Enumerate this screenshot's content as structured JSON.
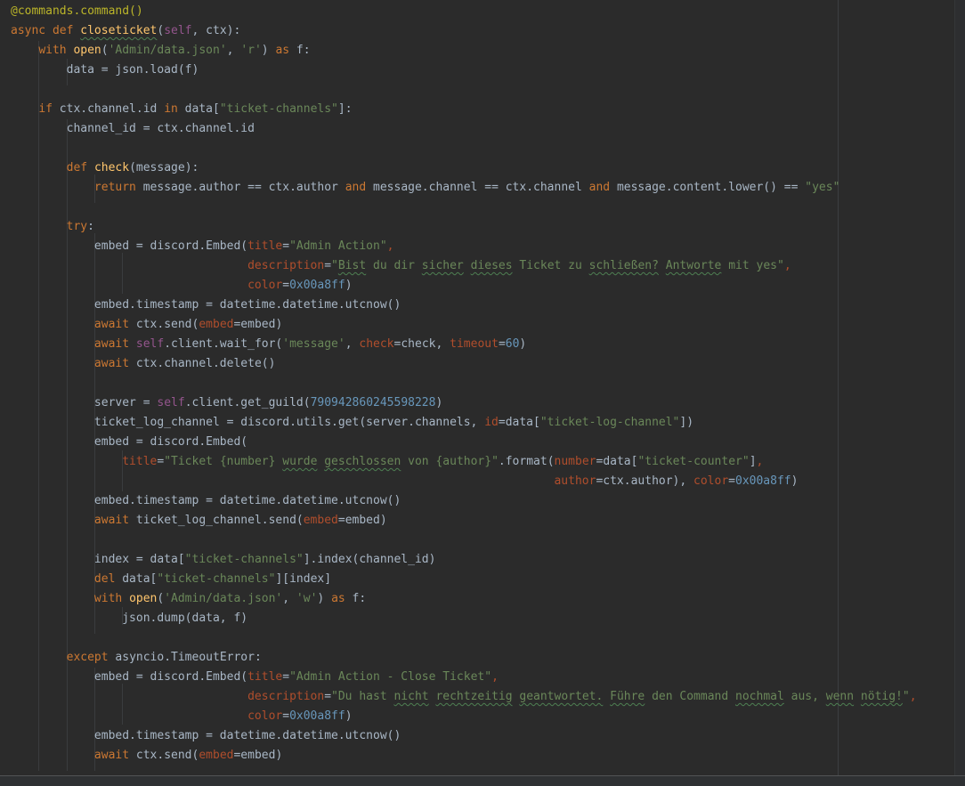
{
  "editor": {
    "language": "python",
    "palette": {
      "bg": "#2b2b2b",
      "d": "#a9b7c6",
      "kw": "#cc7832",
      "dec": "#bbb529",
      "fn": "#ffc66d",
      "str": "#6a8759",
      "num": "#6897bb",
      "self": "#94558d",
      "arg": "#b04e2c",
      "embed_color_value": "0x00a8ff",
      "guild_id": "790942860245598228",
      "timeout_value": "60"
    },
    "lines": [
      [
        {
          "t": "@commands.command()",
          "c": "dec"
        }
      ],
      [
        {
          "t": "async",
          "c": "kw"
        },
        {
          "t": " ",
          "c": "d"
        },
        {
          "t": "def",
          "c": "kw"
        },
        {
          "t": " ",
          "c": "d"
        },
        {
          "t": "closeticket",
          "c": "fn",
          "u": 1
        },
        {
          "t": "(",
          "c": "d"
        },
        {
          "t": "self",
          "c": "self"
        },
        {
          "t": ", ctx):",
          "c": "d"
        }
      ],
      [
        {
          "t": "    ",
          "c": "d"
        },
        {
          "t": "with",
          "c": "kw"
        },
        {
          "t": " ",
          "c": "d"
        },
        {
          "t": "open",
          "c": "fn"
        },
        {
          "t": "(",
          "c": "d"
        },
        {
          "t": "'Admin/data.json'",
          "c": "str"
        },
        {
          "t": ", ",
          "c": "d"
        },
        {
          "t": "'r'",
          "c": "str"
        },
        {
          "t": ") ",
          "c": "d"
        },
        {
          "t": "as",
          "c": "kw"
        },
        {
          "t": " f:",
          "c": "d"
        }
      ],
      [
        {
          "t": "        data = json.load(f)",
          "c": "d"
        }
      ],
      [],
      [
        {
          "t": "    ",
          "c": "d"
        },
        {
          "t": "if",
          "c": "kw"
        },
        {
          "t": " ctx.channel.id ",
          "c": "d"
        },
        {
          "t": "in",
          "c": "kw"
        },
        {
          "t": " data[",
          "c": "d"
        },
        {
          "t": "\"ticket-channels\"",
          "c": "str"
        },
        {
          "t": "]:",
          "c": "d"
        }
      ],
      [
        {
          "t": "        channel_id = ctx.channel.id",
          "c": "d"
        }
      ],
      [],
      [
        {
          "t": "        ",
          "c": "d"
        },
        {
          "t": "def",
          "c": "kw"
        },
        {
          "t": " ",
          "c": "d"
        },
        {
          "t": "check",
          "c": "fn"
        },
        {
          "t": "(message):",
          "c": "d"
        }
      ],
      [
        {
          "t": "            ",
          "c": "d"
        },
        {
          "t": "return",
          "c": "kw"
        },
        {
          "t": " message.author == ctx.author ",
          "c": "d"
        },
        {
          "t": "and",
          "c": "kw"
        },
        {
          "t": " message.channel == ctx.channel ",
          "c": "d"
        },
        {
          "t": "and",
          "c": "kw"
        },
        {
          "t": " message.content.lower() == ",
          "c": "d"
        },
        {
          "t": "\"yes\"",
          "c": "str"
        }
      ],
      [],
      [
        {
          "t": "        ",
          "c": "d"
        },
        {
          "t": "try",
          "c": "kw"
        },
        {
          "t": ":",
          "c": "d"
        }
      ],
      [
        {
          "t": "            embed = discord.Embed(",
          "c": "d"
        },
        {
          "t": "title",
          "c": "arg"
        },
        {
          "t": "=",
          "c": "d"
        },
        {
          "t": "\"Admin Action\"",
          "c": "str"
        },
        {
          "t": ",",
          "c": "arg"
        }
      ],
      [
        {
          "t": "                                  ",
          "c": "d"
        },
        {
          "t": "description",
          "c": "arg"
        },
        {
          "t": "=",
          "c": "d"
        },
        {
          "t": "\"",
          "c": "str"
        },
        {
          "t": "Bist",
          "c": "str",
          "u": 1
        },
        {
          "t": " du dir ",
          "c": "str"
        },
        {
          "t": "sicher",
          "c": "str",
          "u": 1
        },
        {
          "t": " ",
          "c": "str"
        },
        {
          "t": "dieses",
          "c": "str",
          "u": 1
        },
        {
          "t": " Ticket zu ",
          "c": "str"
        },
        {
          "t": "schließen?",
          "c": "str",
          "u": 1
        },
        {
          "t": " ",
          "c": "str"
        },
        {
          "t": "Antworte",
          "c": "str",
          "u": 1
        },
        {
          "t": " mit yes\"",
          "c": "str"
        },
        {
          "t": ",",
          "c": "arg"
        }
      ],
      [
        {
          "t": "                                  ",
          "c": "d"
        },
        {
          "t": "color",
          "c": "arg"
        },
        {
          "t": "=",
          "c": "d"
        },
        {
          "t": "0x00a8ff",
          "c": "num"
        },
        {
          "t": ")",
          "c": "d"
        }
      ],
      [
        {
          "t": "            embed.timestamp = datetime.datetime.utcnow()",
          "c": "d"
        }
      ],
      [
        {
          "t": "            ",
          "c": "d"
        },
        {
          "t": "await",
          "c": "kw"
        },
        {
          "t": " ctx.send(",
          "c": "d"
        },
        {
          "t": "embed",
          "c": "arg"
        },
        {
          "t": "=embed)",
          "c": "d"
        }
      ],
      [
        {
          "t": "            ",
          "c": "d"
        },
        {
          "t": "await",
          "c": "kw"
        },
        {
          "t": " ",
          "c": "d"
        },
        {
          "t": "self",
          "c": "self"
        },
        {
          "t": ".client.wait_for(",
          "c": "d"
        },
        {
          "t": "'message'",
          "c": "str"
        },
        {
          "t": ", ",
          "c": "d"
        },
        {
          "t": "check",
          "c": "arg"
        },
        {
          "t": "=check, ",
          "c": "d"
        },
        {
          "t": "timeout",
          "c": "arg"
        },
        {
          "t": "=",
          "c": "d"
        },
        {
          "t": "60",
          "c": "num"
        },
        {
          "t": ")",
          "c": "d"
        }
      ],
      [
        {
          "t": "            ",
          "c": "d"
        },
        {
          "t": "await",
          "c": "kw"
        },
        {
          "t": " ctx.channel.delete()",
          "c": "d"
        }
      ],
      [],
      [
        {
          "t": "            server = ",
          "c": "d"
        },
        {
          "t": "self",
          "c": "self"
        },
        {
          "t": ".client.get_guild(",
          "c": "d"
        },
        {
          "t": "790942860245598228",
          "c": "num"
        },
        {
          "t": ")",
          "c": "d"
        }
      ],
      [
        {
          "t": "            ticket_log_channel = discord.utils.get(server.channels, ",
          "c": "d"
        },
        {
          "t": "id",
          "c": "arg"
        },
        {
          "t": "=data[",
          "c": "d"
        },
        {
          "t": "\"ticket-log-channel\"",
          "c": "str"
        },
        {
          "t": "])",
          "c": "d"
        }
      ],
      [
        {
          "t": "            embed = discord.Embed(",
          "c": "d"
        }
      ],
      [
        {
          "t": "                ",
          "c": "d"
        },
        {
          "t": "title",
          "c": "arg"
        },
        {
          "t": "=",
          "c": "d"
        },
        {
          "t": "\"Ticket {number} ",
          "c": "str"
        },
        {
          "t": "wurde",
          "c": "str",
          "u": 1
        },
        {
          "t": " ",
          "c": "str"
        },
        {
          "t": "geschlossen",
          "c": "str",
          "u": 1
        },
        {
          "t": " von {author}\"",
          "c": "str"
        },
        {
          "t": ".format(",
          "c": "d"
        },
        {
          "t": "number",
          "c": "arg"
        },
        {
          "t": "=data[",
          "c": "d"
        },
        {
          "t": "\"ticket-counter\"",
          "c": "str"
        },
        {
          "t": "]",
          "c": "d"
        },
        {
          "t": ",",
          "c": "arg"
        }
      ],
      [
        {
          "t": "                                                                              ",
          "c": "d"
        },
        {
          "t": "author",
          "c": "arg"
        },
        {
          "t": "=ctx.author), ",
          "c": "d"
        },
        {
          "t": "color",
          "c": "arg"
        },
        {
          "t": "=",
          "c": "d"
        },
        {
          "t": "0x00a8ff",
          "c": "num"
        },
        {
          "t": ")",
          "c": "d"
        }
      ],
      [
        {
          "t": "            embed.timestamp = datetime.datetime.utcnow()",
          "c": "d"
        }
      ],
      [
        {
          "t": "            ",
          "c": "d"
        },
        {
          "t": "await",
          "c": "kw"
        },
        {
          "t": " ticket_log_channel.send(",
          "c": "d"
        },
        {
          "t": "embed",
          "c": "arg"
        },
        {
          "t": "=embed)",
          "c": "d"
        }
      ],
      [],
      [
        {
          "t": "            index = data[",
          "c": "d"
        },
        {
          "t": "\"ticket-channels\"",
          "c": "str"
        },
        {
          "t": "].index(channel_id)",
          "c": "d"
        }
      ],
      [
        {
          "t": "            ",
          "c": "d"
        },
        {
          "t": "del",
          "c": "kw"
        },
        {
          "t": " data[",
          "c": "d"
        },
        {
          "t": "\"ticket-channels\"",
          "c": "str"
        },
        {
          "t": "][index]",
          "c": "d"
        }
      ],
      [
        {
          "t": "            ",
          "c": "d"
        },
        {
          "t": "with",
          "c": "kw"
        },
        {
          "t": " ",
          "c": "d"
        },
        {
          "t": "open",
          "c": "fn"
        },
        {
          "t": "(",
          "c": "d"
        },
        {
          "t": "'Admin/data.json'",
          "c": "str"
        },
        {
          "t": ", ",
          "c": "d"
        },
        {
          "t": "'w'",
          "c": "str"
        },
        {
          "t": ") ",
          "c": "d"
        },
        {
          "t": "as",
          "c": "kw"
        },
        {
          "t": " f:",
          "c": "d"
        }
      ],
      [
        {
          "t": "                json.dump(data, f)",
          "c": "d"
        }
      ],
      [],
      [
        {
          "t": "        ",
          "c": "d"
        },
        {
          "t": "except",
          "c": "kw"
        },
        {
          "t": " asyncio.TimeoutError:",
          "c": "d"
        }
      ],
      [
        {
          "t": "            embed = discord.Embed(",
          "c": "d"
        },
        {
          "t": "title",
          "c": "arg"
        },
        {
          "t": "=",
          "c": "d"
        },
        {
          "t": "\"Admin Action - Close Ticket\"",
          "c": "str"
        },
        {
          "t": ",",
          "c": "arg"
        }
      ],
      [
        {
          "t": "                                  ",
          "c": "d"
        },
        {
          "t": "description",
          "c": "arg"
        },
        {
          "t": "=",
          "c": "d"
        },
        {
          "t": "\"Du hast ",
          "c": "str"
        },
        {
          "t": "nicht",
          "c": "str",
          "u": 1
        },
        {
          "t": " ",
          "c": "str"
        },
        {
          "t": "rechtzeitig",
          "c": "str",
          "u": 1
        },
        {
          "t": " ",
          "c": "str"
        },
        {
          "t": "geantwortet.",
          "c": "str",
          "u": 1
        },
        {
          "t": " ",
          "c": "str"
        },
        {
          "t": "Führe",
          "c": "str",
          "u": 1
        },
        {
          "t": " den Command ",
          "c": "str"
        },
        {
          "t": "nochmal",
          "c": "str",
          "u": 1
        },
        {
          "t": " aus, ",
          "c": "str"
        },
        {
          "t": "wenn",
          "c": "str",
          "u": 1
        },
        {
          "t": " ",
          "c": "str"
        },
        {
          "t": "nötig!",
          "c": "str",
          "u": 1
        },
        {
          "t": "\"",
          "c": "str"
        },
        {
          "t": ",",
          "c": "arg"
        }
      ],
      [
        {
          "t": "                                  ",
          "c": "d"
        },
        {
          "t": "color",
          "c": "arg"
        },
        {
          "t": "=",
          "c": "d"
        },
        {
          "t": "0x00a8ff",
          "c": "num"
        },
        {
          "t": ")",
          "c": "d"
        }
      ],
      [
        {
          "t": "            embed.timestamp = datetime.datetime.utcnow()",
          "c": "d"
        }
      ],
      [
        {
          "t": "            ",
          "c": "d"
        },
        {
          "t": "await",
          "c": "kw"
        },
        {
          "t": " ctx.send(",
          "c": "d"
        },
        {
          "t": "embed",
          "c": "arg"
        },
        {
          "t": "=embed)",
          "c": "d"
        }
      ]
    ]
  }
}
